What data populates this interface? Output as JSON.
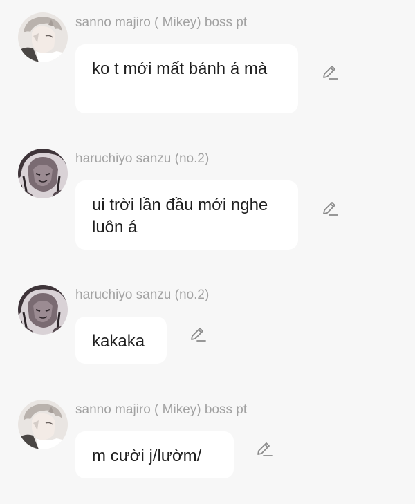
{
  "messages": [
    {
      "sender": "sanno majiro ( Mikey) boss pt",
      "text": "ko t mới mất bánh á mà",
      "avatar_icon": "mikey-avatar-icon"
    },
    {
      "sender": "haruchiyo sanzu (no.2)",
      "text": "ui trời lần đầu mới nghe luôn á",
      "avatar_icon": "sanzu-avatar-icon"
    },
    {
      "sender": "haruchiyo sanzu (no.2)",
      "text": "kakaka",
      "avatar_icon": "sanzu-avatar-icon"
    },
    {
      "sender": "sanno majiro ( Mikey) boss pt",
      "text": "m cười j/lườm/",
      "avatar_icon": "mikey-avatar-icon"
    }
  ],
  "icons": {
    "edit": "pencil-edit-icon"
  },
  "colors": {
    "background": "#f7f7f7",
    "bubble": "#ffffff",
    "sender_text": "#a2a2a2",
    "message_text": "#1f1f1f",
    "icon": "#8a8a8a"
  }
}
